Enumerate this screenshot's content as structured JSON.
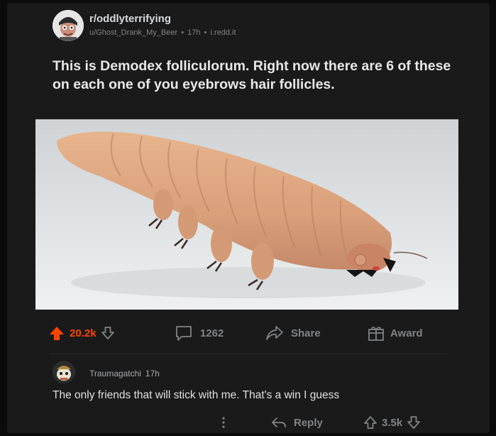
{
  "post": {
    "subreddit": "r/oddlyterrifying",
    "author": "u/Ghost_Drank_My_Beer",
    "separator": "•",
    "age": "17h",
    "domain": "i.redd.it",
    "title": "This is Demodex folliculorum. Right now there are 6 of these on each one of you eyebrows hair follicles.",
    "upvotes": "20.2k",
    "comments": "1262",
    "share_label": "Share",
    "award_label": "Award"
  },
  "comment": {
    "user": "Traumagatchi",
    "age": "17h",
    "body": "The only friends that will stick with me. That's a win I guess",
    "reply_label": "Reply",
    "score": "3.5k"
  },
  "colors": {
    "upvote_active": "#ff4500",
    "muted": "#818384",
    "card_bg": "#1a1a1b"
  },
  "icons": {
    "more": "more-vertical-icon",
    "reply": "reply-arrow-icon",
    "upvote": "upvote-arrow-icon",
    "downvote": "downvote-arrow-icon",
    "comment": "comment-bubble-icon",
    "share": "share-arrow-icon",
    "award": "gift-box-icon"
  }
}
